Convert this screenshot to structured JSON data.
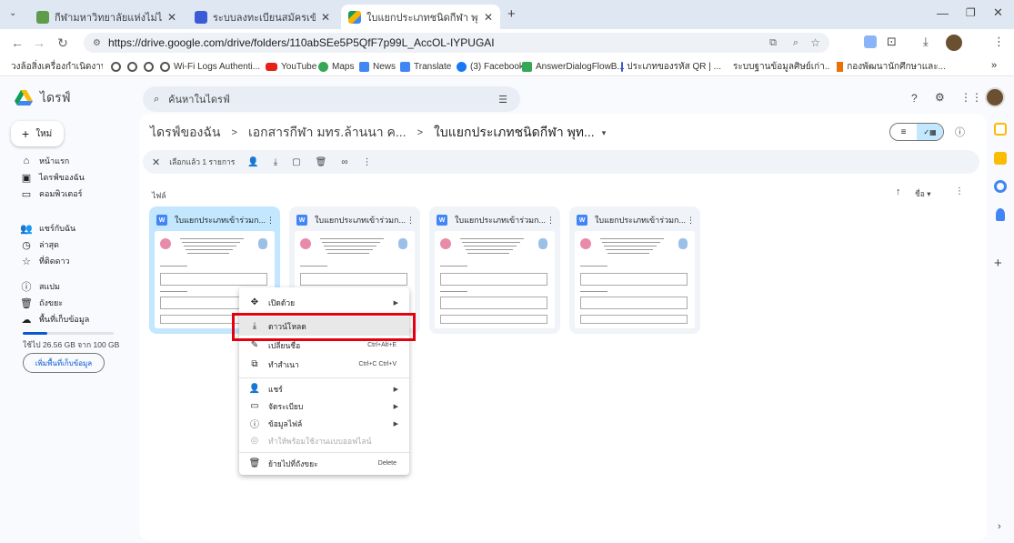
{
  "browser": {
    "tabs": [
      {
        "title": "กีฬามหาวิทยาลัยแห่งไม่ได้ราชมงคล",
        "favicon_color": "#5e9b4a",
        "active": false
      },
      {
        "title": "ระบบลงทะเบียนสมัครเข้าร่วมการแข่ง",
        "favicon_color": "#3b5bd6",
        "active": false
      },
      {
        "title": "ใบแยกประเภทชนิดกีฬา พุทธรักษาก",
        "favicon_color": "#f4b400",
        "active": true
      }
    ],
    "new_tab": "+",
    "url": "https://drive.google.com/drive/folders/110abSEe5P5QfF7p99L_AccOL-IYPUGAI",
    "bookmarks": [
      "วงล้อสิ่งเครื่องกำเนิดงาน...",
      "Wi-Fi Logs Authenti...",
      "YouTube",
      "Maps",
      "News",
      "Translate",
      "(3) Facebook",
      "AnswerDialogFlowB...",
      "ประเภทของรหัส QR | ...",
      "ระบบฐานข้อมูลศิษย์เก่า...",
      "กองพัฒนานักศึกษาและ..."
    ],
    "bookmarks_more": "»"
  },
  "drive": {
    "logo_text": "ไดรฟ์",
    "search_placeholder": "ค้นหาในไดรฟ์",
    "new_button": "ใหม่",
    "sidebar": [
      {
        "label": "หน้าแรก",
        "icon": "home-icon"
      },
      {
        "label": "ไดรฟ์ของฉัน",
        "icon": "my-drive-icon"
      },
      {
        "label": "คอมพิวเตอร์",
        "icon": "computer-icon"
      },
      {
        "label": "แชร์กับฉัน",
        "icon": "shared-icon"
      },
      {
        "label": "ล่าสุด",
        "icon": "clock-icon"
      },
      {
        "label": "ที่ติดดาว",
        "icon": "star-icon"
      },
      {
        "label": "สแปม",
        "icon": "spam-icon"
      },
      {
        "label": "ถังขยะ",
        "icon": "trash-icon"
      },
      {
        "label": "พื้นที่เก็บข้อมูล",
        "icon": "cloud-icon"
      }
    ],
    "storage_text": "ใช้ไป 26.56 GB จาก 100 GB",
    "storage_used_fraction": 0.27,
    "storage_button": "เพิ่มพื้นที่เก็บข้อมูล",
    "breadcrumb": [
      "ไดรฟ์ของฉัน",
      "เอกสารกีฬา มทร.ล้านนา ค...",
      "ใบแยกประเภทชนิดกีฬา พุท..."
    ],
    "breadcrumb_sep": ">",
    "selection_text": "เลือกแล้ว 1 รายการ",
    "section_label": "ไฟล์",
    "sort_label": "ชื่อ",
    "file_badge": "W",
    "files": [
      {
        "name": "ใบแยกประเภทเข้าร่วมก...",
        "selected": true
      },
      {
        "name": "ใบแยกประเภทเข้าร่วมก...",
        "selected": false
      },
      {
        "name": "ใบแยกประเภทเข้าร่วมก...",
        "selected": false
      },
      {
        "name": "ใบแยกประเภทเข้าร่วมก...",
        "selected": false
      }
    ]
  },
  "context_menu": {
    "items": [
      {
        "label": "เปิดด้วย",
        "icon": "open-with-icon",
        "shortcut": "",
        "submenu": true,
        "disabled": false,
        "highlight": false
      },
      {
        "label": "ดาวน์โหลด",
        "icon": "download-icon",
        "shortcut": "",
        "submenu": false,
        "disabled": false,
        "highlight": true
      },
      {
        "label": "เปลี่ยนชื่อ",
        "icon": "rename-icon",
        "shortcut": "Ctrl+Alt+E",
        "submenu": false,
        "disabled": false,
        "highlight": false
      },
      {
        "label": "ทำสำเนา",
        "icon": "copy-icon",
        "shortcut": "Ctrl+C Ctrl+V",
        "submenu": false,
        "disabled": false,
        "highlight": false
      },
      {
        "label": "แชร์",
        "icon": "share-icon",
        "shortcut": "",
        "submenu": true,
        "disabled": false,
        "highlight": false
      },
      {
        "label": "จัดระเบียบ",
        "icon": "organize-icon",
        "shortcut": "",
        "submenu": true,
        "disabled": false,
        "highlight": false
      },
      {
        "label": "ข้อมูลไฟล์",
        "icon": "info-icon",
        "shortcut": "",
        "submenu": true,
        "disabled": false,
        "highlight": false
      },
      {
        "label": "ทำให้พร้อมใช้งานแบบออฟไลน์",
        "icon": "offline-icon",
        "shortcut": "",
        "submenu": false,
        "disabled": true,
        "highlight": false
      },
      {
        "label": "ย้ายไปที่ถังขยะ",
        "icon": "trash-icon",
        "shortcut": "Delete",
        "submenu": false,
        "disabled": false,
        "highlight": false
      }
    ],
    "highlight_color": "#e3000f"
  }
}
